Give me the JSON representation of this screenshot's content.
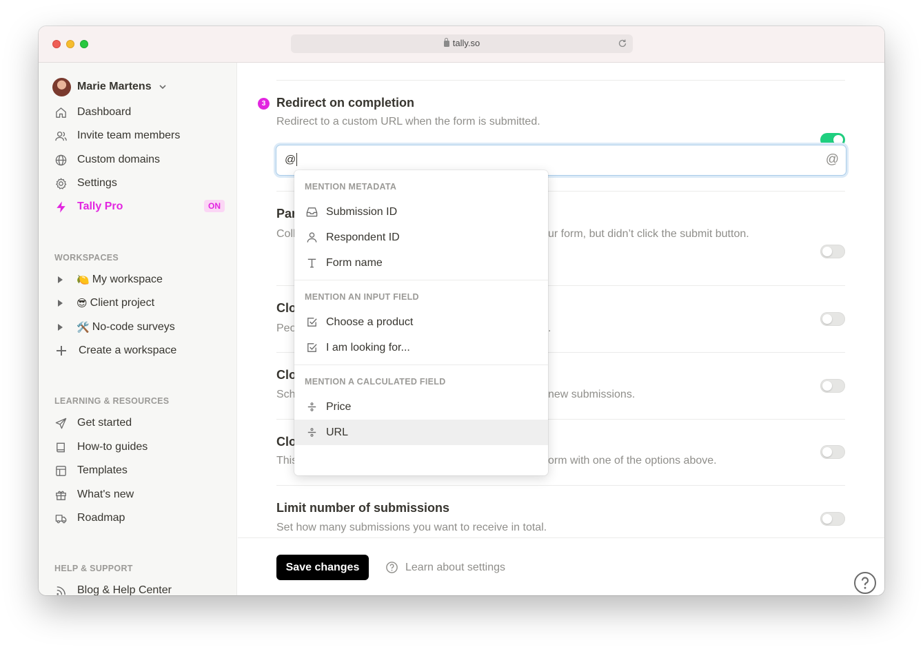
{
  "browser": {
    "url": "tally.so"
  },
  "sidebar": {
    "user": {
      "name": "Marie Martens"
    },
    "nav": [
      {
        "label": "Dashboard",
        "icon": "home-icon"
      },
      {
        "label": "Invite team members",
        "icon": "users-icon"
      },
      {
        "label": "Custom domains",
        "icon": "globe-icon"
      },
      {
        "label": "Settings",
        "icon": "gear-icon"
      },
      {
        "label": "Tally Pro",
        "icon": "bolt-icon",
        "badge": "ON"
      }
    ],
    "workspaces_heading": "WORKSPACES",
    "workspaces": [
      {
        "emoji": "🍋",
        "label": "My workspace"
      },
      {
        "emoji": "😎",
        "label": "Client project"
      },
      {
        "emoji": "🛠️",
        "label": "No-code surveys"
      }
    ],
    "create_workspace": "Create a workspace",
    "learning_heading": "LEARNING & RESOURCES",
    "learning": [
      {
        "label": "Get started",
        "icon": "send-icon"
      },
      {
        "label": "How-to guides",
        "icon": "book-icon"
      },
      {
        "label": "Templates",
        "icon": "layout-icon"
      },
      {
        "label": "What's new",
        "icon": "gift-icon"
      },
      {
        "label": "Roadmap",
        "icon": "truck-icon"
      }
    ],
    "help_heading": "HELP & SUPPORT",
    "help": [
      {
        "label": "Blog & Help Center",
        "icon": "rss-icon"
      }
    ]
  },
  "main": {
    "step_number": "3",
    "redirect": {
      "title": "Redirect on completion",
      "description": "Redirect to a custom URL when the form is submitted.",
      "enabled": true,
      "input_value": "@"
    },
    "settings": [
      {
        "title_visible": "Par",
        "desc_visible_left": "Coll",
        "desc_visible_right": "ur form, but didn’t click the submit button.",
        "enabled": false
      },
      {
        "title_visible": "Clo",
        "desc_visible_left": "Peo",
        "desc_visible_right": ".",
        "enabled": false
      },
      {
        "title_visible": "Clo",
        "desc_visible_left": "Sch",
        "desc_visible_right": "new submissions.",
        "enabled": false
      },
      {
        "title_visible": "Clo",
        "desc_visible_left": "This",
        "desc_visible_right": "orm with one of the options above.",
        "enabled": false
      },
      {
        "title": "Limit number of submissions",
        "description": "Set how many submissions you want to receive in total.",
        "enabled": false
      }
    ],
    "footer": {
      "save_label": "Save changes",
      "learn_label": "Learn about settings"
    }
  },
  "mention_menu": {
    "sections": [
      {
        "heading": "MENTION METADATA",
        "items": [
          {
            "label": "Submission ID",
            "icon": "inbox-icon"
          },
          {
            "label": "Respondent ID",
            "icon": "user-icon"
          },
          {
            "label": "Form name",
            "icon": "text-icon"
          }
        ]
      },
      {
        "heading": "MENTION AN INPUT FIELD",
        "items": [
          {
            "label": "Choose a product",
            "icon": "checkbox-icon"
          },
          {
            "label": "I am looking for...",
            "icon": "checkbox-icon"
          }
        ]
      },
      {
        "heading": "MENTION A CALCULATED FIELD",
        "items": [
          {
            "label": "Price",
            "icon": "divide-icon"
          },
          {
            "label": "URL",
            "icon": "divide-icon",
            "highlighted": true
          }
        ]
      }
    ]
  },
  "colors": {
    "accent_pink": "#e226e0",
    "toggle_on": "#1fcf7f",
    "focus_ring": "#a9cce9"
  }
}
